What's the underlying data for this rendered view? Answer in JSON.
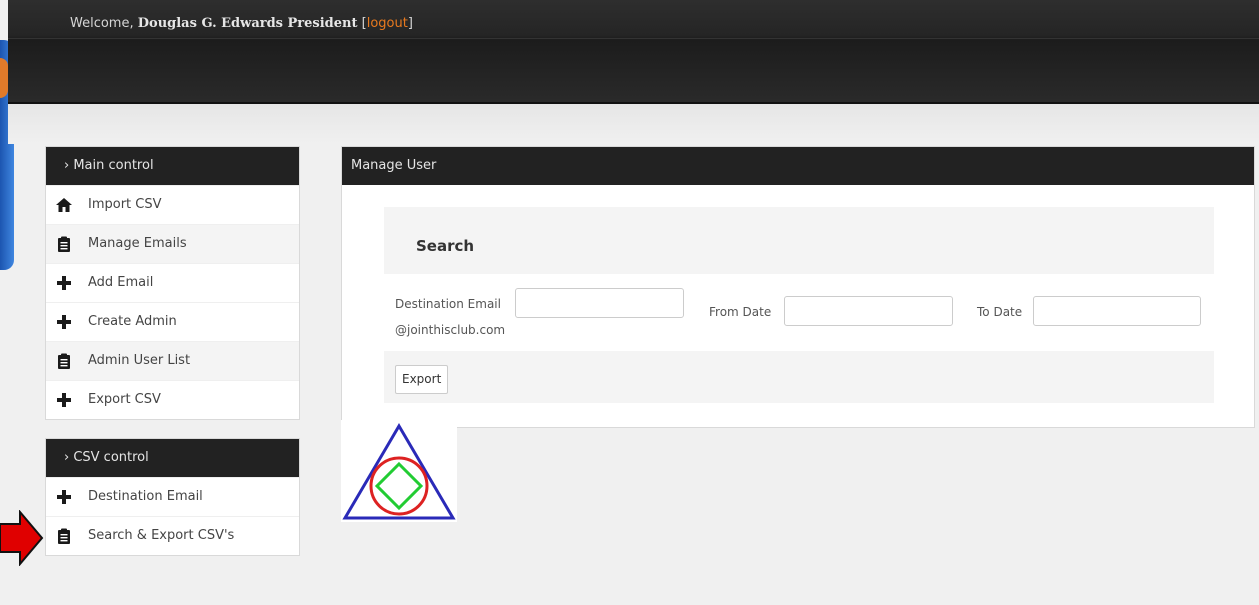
{
  "header": {
    "welcome_prefix": "Welcome,",
    "user_name": "Douglas G. Edwards President",
    "bracket_open": "[",
    "logout_label": "logout",
    "bracket_close": "]"
  },
  "sidebar": {
    "main_control": {
      "title": "› Main control",
      "items": [
        {
          "label": "Import CSV",
          "icon": "home-icon"
        },
        {
          "label": "Manage Emails",
          "icon": "clipboard-icon"
        },
        {
          "label": "Add Email",
          "icon": "plus-icon"
        },
        {
          "label": "Create Admin",
          "icon": "plus-icon"
        },
        {
          "label": "Admin User List",
          "icon": "clipboard-icon"
        },
        {
          "label": "Export CSV",
          "icon": "plus-icon"
        }
      ]
    },
    "csv_control": {
      "title": "› CSV control",
      "items": [
        {
          "label": "Destination Email",
          "icon": "plus-icon"
        },
        {
          "label": "Search & Export CSV's",
          "icon": "clipboard-icon"
        }
      ]
    }
  },
  "main": {
    "panel_title": "Manage User",
    "search_title": "Search",
    "destination_label": "Destination Email",
    "destination_domain": "@jointhisclub.com",
    "from_date_label": "From Date",
    "to_date_label": "To Date",
    "destination_value": "",
    "from_date_value": "",
    "to_date_value": "",
    "export_label": "Export"
  },
  "colors": {
    "header_bg": "#222222",
    "logout": "#e8791e",
    "logo_triangle": "#2a2ab8",
    "logo_circle": "#dd2222",
    "logo_diamond": "#22cc33",
    "arrow": "#e00000"
  }
}
